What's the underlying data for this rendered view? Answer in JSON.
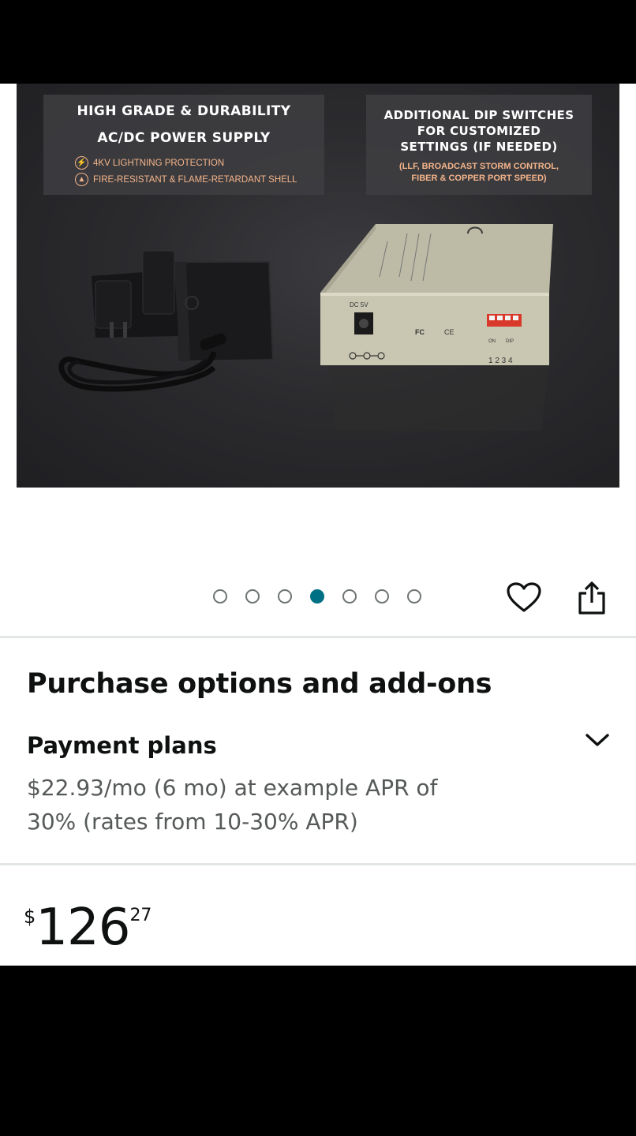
{
  "product_image": {
    "callout_left": {
      "title_line1": "HIGH GRADE & DURABILITY",
      "title_line2": "AC/DC POWER SUPPLY",
      "feature1": "4KV LIGHTNING PROTECTION",
      "feature2": "FIRE-RESISTANT & FLAME-RETARDANT SHELL"
    },
    "callout_right": {
      "title_line1": "ADDITIONAL DIP SWITCHES",
      "title_line2": "FOR CUSTOMIZED",
      "title_line3": "SETTINGS (IF NEEDED)",
      "sub_line1": "(LLF, BROADCAST STORM CONTROL,",
      "sub_line2": "FIBER & COPPER PORT SPEED)"
    },
    "device_labels": {
      "dc": "DC 5V",
      "fc": "FC",
      "ce": "CE",
      "dip_numbers": "1 2 3 4",
      "dip_on": "ON",
      "dip_label": "DIP"
    }
  },
  "carousel": {
    "total": 7,
    "active_index": 3,
    "accent_color": "#007185"
  },
  "icons": {
    "wishlist": "heart-icon",
    "share": "share-icon",
    "expand": "chevron-down-icon"
  },
  "purchase": {
    "title": "Purchase options and add-ons",
    "payment_plans_label": "Payment plans",
    "payment_plans_desc_line1": "$22.93/mo (6 mo) at example APR of",
    "payment_plans_desc_line2": "30% (rates from 10-30% APR)"
  },
  "price": {
    "symbol": "$",
    "whole": "126",
    "fraction": "27"
  }
}
